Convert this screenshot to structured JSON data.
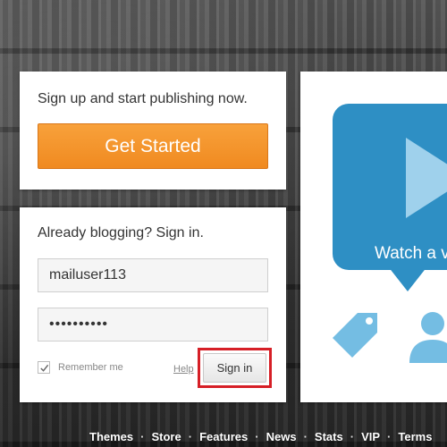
{
  "signup": {
    "prompt": "Sign up and start publishing now.",
    "button_label": "Get Started",
    "button_color": "#f39223"
  },
  "signin": {
    "title": "Already blogging? Sign in.",
    "username_value": "mailuser113",
    "password_value": "••••••••••",
    "remember_label": "Remember me",
    "remember_checked": true,
    "help_label": "Help",
    "button_label": "Sign in",
    "highlight_color": "#d61f26"
  },
  "video": {
    "watch_text": "Watch a v",
    "bubble_color": "#2e8fc4",
    "icons": [
      "play-icon",
      "tag-icon",
      "person-icon"
    ]
  },
  "footer": {
    "links": [
      {
        "label": "Themes"
      },
      {
        "label": "Store"
      },
      {
        "label": "Features"
      },
      {
        "label": "News"
      },
      {
        "label": "Stats"
      },
      {
        "label": "VIP"
      },
      {
        "label": "Terms"
      }
    ],
    "separator": "·"
  }
}
